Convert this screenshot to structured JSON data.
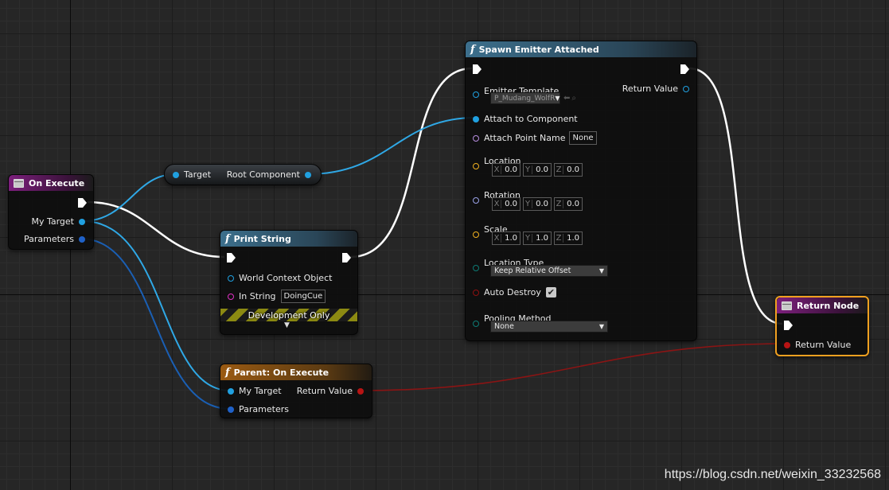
{
  "nodes": {
    "on_execute": {
      "title": "On Execute",
      "pins": {
        "my_target": "My Target",
        "parameters": "Parameters"
      }
    },
    "get_root": {
      "input": "Target",
      "output": "Root Component"
    },
    "print_string": {
      "title": "Print String",
      "world_context": "World Context Object",
      "in_string_label": "In String",
      "in_string_value": "DoingCue",
      "dev_only": "Development Only",
      "expand_glyph": "▼"
    },
    "parent_on_execute": {
      "title": "Parent: On Execute",
      "my_target": "My Target",
      "parameters": "Parameters",
      "return_value": "Return Value"
    },
    "spawn_emitter": {
      "title": "Spawn Emitter Attached",
      "emitter_template": "Emitter Template",
      "emitter_value": "P_Mudang_WolfR",
      "return_value": "Return Value",
      "attach_component": "Attach to Component",
      "attach_point_name": "Attach Point Name",
      "attach_point_value": "None",
      "location": {
        "label": "Location",
        "x": "0.0",
        "y": "0.0",
        "z": "0.0"
      },
      "rotation": {
        "label": "Rotation",
        "x": "0.0",
        "y": "0.0",
        "z": "0.0"
      },
      "scale": {
        "label": "Scale",
        "x": "1.0",
        "y": "1.0",
        "z": "1.0"
      },
      "axis_labels": {
        "x": "X",
        "y": "Y",
        "z": "Z"
      },
      "location_type": {
        "label": "Location Type",
        "value": "Keep Relative Offset"
      },
      "auto_destroy": {
        "label": "Auto Destroy",
        "checked": true
      },
      "pooling_method": {
        "label": "Pooling Method",
        "value": "None"
      }
    },
    "return_node": {
      "title": "Return Node",
      "return_value": "Return Value"
    }
  },
  "icons": {
    "event": "event-icon",
    "function": "function-icon",
    "exec": "exec-pin-icon",
    "dropdown": "chevron-down-icon",
    "checkbox_mark": "✔"
  },
  "colors": {
    "exec_wire": "#ffffff",
    "object_wire": "#2fa8e6",
    "struct_wire": "#1a5fb4",
    "return_wire": "#8a1414",
    "object_pin": "#20a0e0",
    "struct_pin": "#1f61c8",
    "string_pin": "#e02fc4",
    "name_pin": "#b78de0",
    "vector_pin": "#f0b020",
    "rotator_pin": "#9aa2e8",
    "enum_pin": "#0d7a74",
    "bool_pin": "#8e1010",
    "return_pin": "#b81414",
    "selected_border": "#f0a020"
  },
  "watermark": "https://blog.csdn.net/weixin_33232568"
}
